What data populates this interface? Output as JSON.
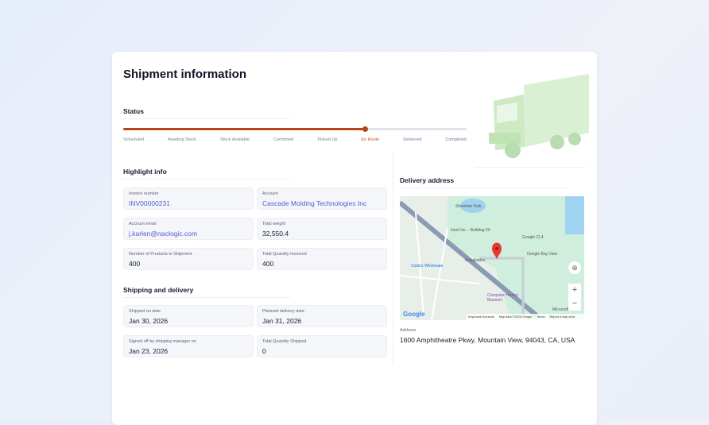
{
  "header": {
    "title": "Shipment information"
  },
  "status": {
    "label": "Status",
    "progress_percent": 70.6,
    "current": "En Route",
    "steps": [
      "Scheduled",
      "Awaiting Stock",
      "Stock Available",
      "Confirmed",
      "Picked Up",
      "En Route",
      "Delivered",
      "Completed"
    ]
  },
  "highlight": {
    "label": "Highlight info",
    "fields": [
      {
        "label": "Invoice number",
        "value": "INV00000231",
        "link": true
      },
      {
        "label": "Account",
        "value": "Cascade Molding Technologies Inc",
        "link": true
      },
      {
        "label": "Account email",
        "value": "j.karlen@naologic.com",
        "link": true
      },
      {
        "label": "Total weight",
        "value": "32,550.4"
      },
      {
        "label": "Number of Products in Shipment",
        "value": "400"
      },
      {
        "label": "Total Quantity Invoiced",
        "value": "400"
      }
    ]
  },
  "shipping": {
    "label": "Shipping and delivery",
    "fields": [
      {
        "label": "Shipped on date",
        "value": "Jan 30, 2026"
      },
      {
        "label": "Planned delivery date",
        "value": "Jan 31, 2026"
      },
      {
        "label": "Signed off by shipping manager on",
        "value": "Jan 23, 2026"
      },
      {
        "label": "Total Quantity Shipped",
        "value": "0"
      }
    ]
  },
  "delivery": {
    "label": "Delivery address",
    "address_label": "Address",
    "address": "1600 Amphitheatre Pkwy, Mountain View, 94043, CA, USA",
    "map": {
      "places": [
        "Shoreline Park",
        "Intuit Inc. - Building 20",
        "Google CL4",
        "Google Bay View",
        "Googleplex",
        "Costco Wholesale",
        "Computer History Museum",
        "Microsoft"
      ],
      "logo": "Google",
      "footer": [
        "Keyboard shortcuts",
        "Map data ©2026 Google",
        "Terms",
        "Report a map error"
      ],
      "zoom_in": "+",
      "zoom_out": "−"
    }
  }
}
